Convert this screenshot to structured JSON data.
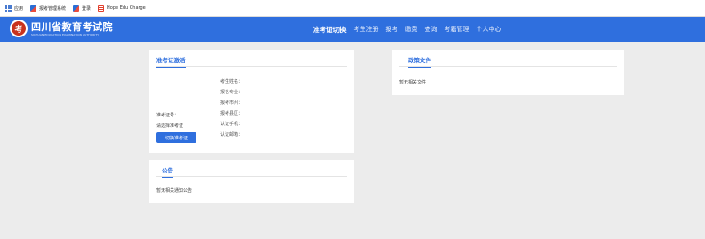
{
  "bookmarks": {
    "items": [
      {
        "label": "应用",
        "icon": "apps-grid-icon"
      },
      {
        "label": "报考管理系统",
        "icon": "favicon-icon"
      },
      {
        "label": "登录",
        "icon": "favicon-icon"
      },
      {
        "label": "Hope Edu Charge",
        "icon": "favicon-red-icon"
      }
    ]
  },
  "header": {
    "logo_mark": "考",
    "logo_cn": "四川省教育考试院",
    "logo_en": "SICHUAN EDUCATION EXAMINATION AUTHORITY",
    "nav": [
      {
        "label": "准考证切换",
        "active": true
      },
      {
        "label": "考生注册",
        "active": false
      },
      {
        "label": "报考",
        "active": false
      },
      {
        "label": "缴费",
        "active": false
      },
      {
        "label": "查询",
        "active": false
      },
      {
        "label": "考籍管理",
        "active": false
      },
      {
        "label": "个人中心",
        "active": false
      }
    ],
    "brand_color": "#2f6fde"
  },
  "admission_card": {
    "title": "准考证激活",
    "ticket_label": "准考证号：",
    "select_label": "请选择准考证",
    "activate_button": "切换准考证",
    "info": [
      "考生姓名：",
      "报名专业：",
      "报考市州：",
      "报考县区：",
      "认证手机：",
      "认证邮箱："
    ]
  },
  "policy_card": {
    "title": "政策文件",
    "empty_text": "暂无相关文件"
  },
  "notice_card": {
    "title": "公告",
    "empty_text": "暂无相关通知公告"
  }
}
